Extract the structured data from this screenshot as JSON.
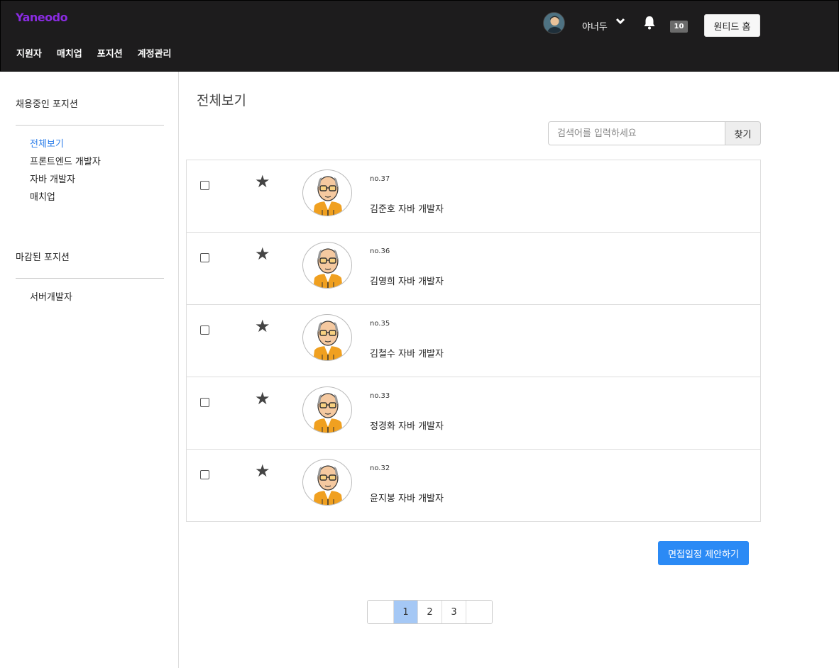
{
  "header": {
    "logo": "Yaneodo",
    "nav": [
      "지원자",
      "매치업",
      "포지션",
      "계정관리"
    ],
    "username": "야너두",
    "notification_count": "10",
    "home_button": "원티드 홈"
  },
  "sidebar": {
    "open_title": "채용중인 포지션",
    "open_items": [
      "전체보기",
      "프론트엔드 개발자",
      "자바 개발자",
      "매치업"
    ],
    "closed_title": "마감된 포지션",
    "closed_items": [
      "서버개발자"
    ]
  },
  "main": {
    "title": "전체보기",
    "search_placeholder": "검색어를 입력하세요",
    "search_button": "찾기",
    "applicants": [
      {
        "no": "no.37",
        "name": "김준호 자바 개발자"
      },
      {
        "no": "no.36",
        "name": "김영희 자바 개발자"
      },
      {
        "no": "no.35",
        "name": "김철수 자바 개발자"
      },
      {
        "no": "no.33",
        "name": "정경화 자바 개발자"
      },
      {
        "no": "no.32",
        "name": "윤지봉 자바 개발자"
      }
    ],
    "propose_button": "면접일정 제안하기",
    "pages": [
      "1",
      "2",
      "3"
    ],
    "current_page": "1"
  },
  "colors": {
    "header_bg": "#1d1c1d",
    "logo": "#8a2be2",
    "accent": "#2b8af5",
    "active_link": "#2b7de9",
    "active_page": "#a5c8f5"
  }
}
